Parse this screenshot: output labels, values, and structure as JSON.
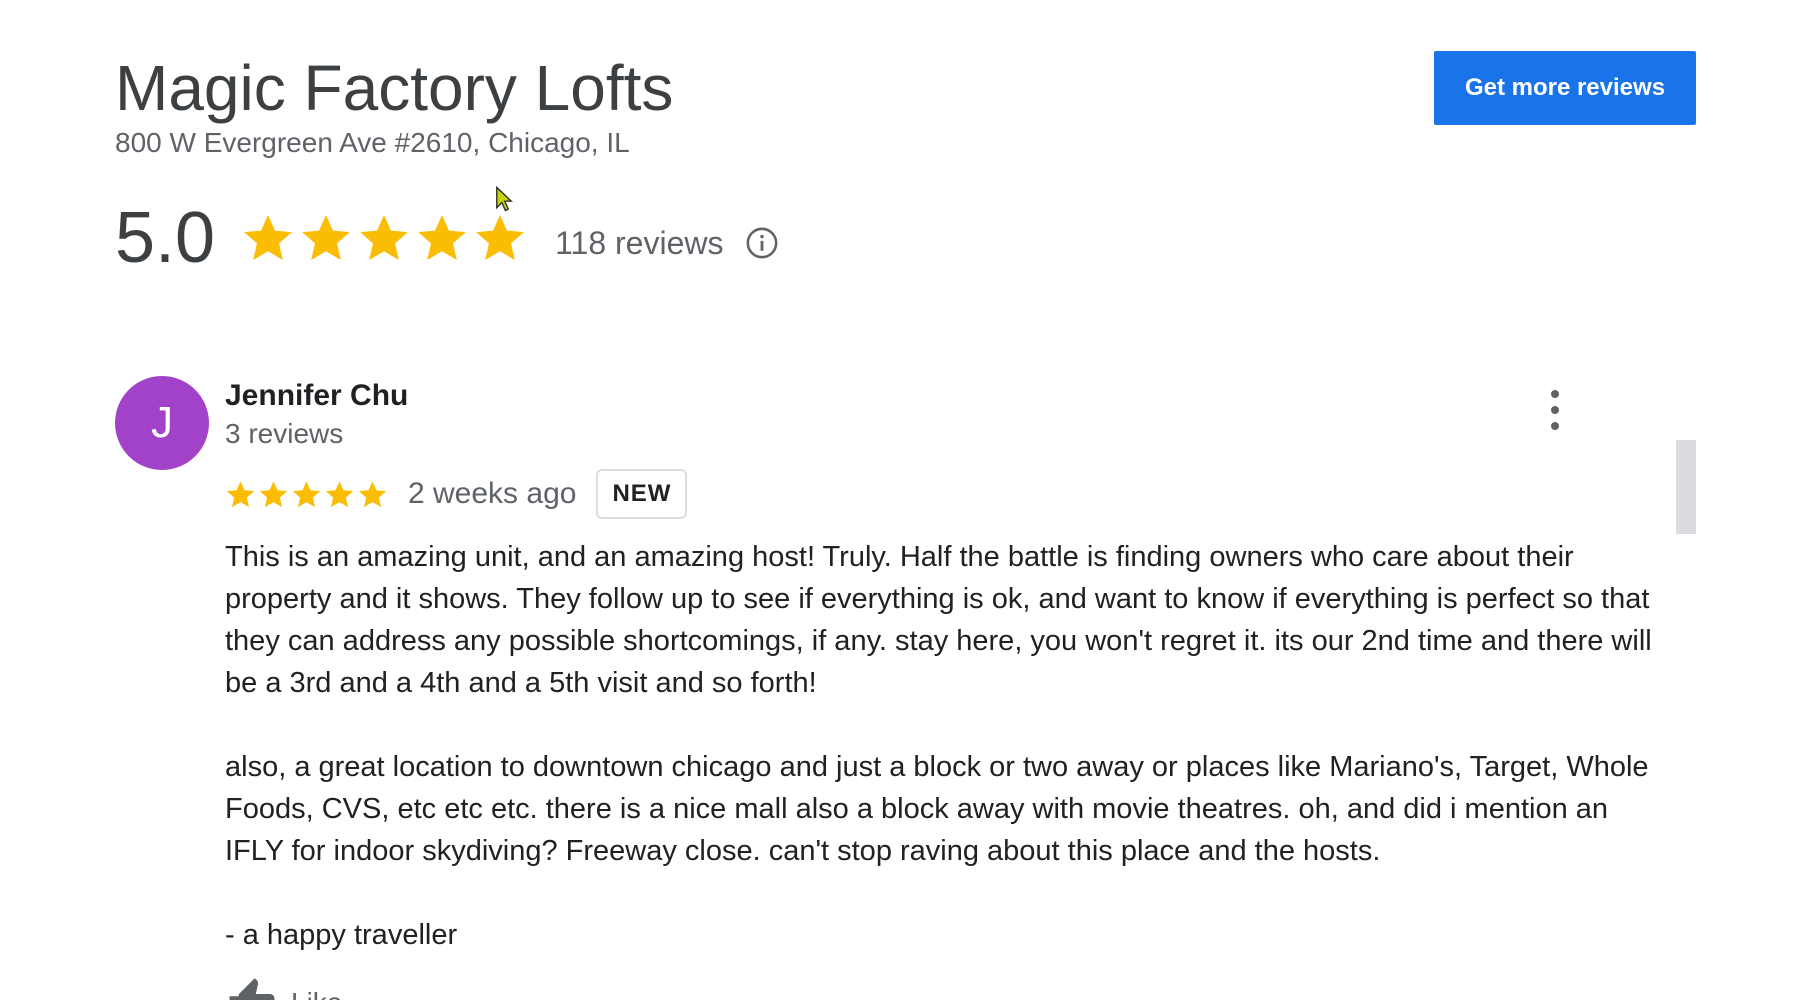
{
  "header": {
    "business_name": "Magic Factory Lofts",
    "address": "800 W Evergreen Ave #2610, Chicago, IL",
    "cta_label": "Get more reviews"
  },
  "summary": {
    "rating": "5.0",
    "rating_value": 5,
    "max_stars": 5,
    "review_count": "118 reviews",
    "star_color": "#fbbc04"
  },
  "colors": {
    "accent": "#1a73e8",
    "avatar": "#a142c9"
  },
  "review": {
    "avatar_initial": "J",
    "reviewer_name": "Jennifer Chu",
    "reviewer_review_count": "3 reviews",
    "stars": 5,
    "date": "2 weeks ago",
    "badge": "NEW",
    "paragraphs": [
      "This is an amazing unit, and an amazing host! Truly.  Half the battle is finding owners who care about their property and it shows.  They follow up to see if everything is ok, and want to know if everything is perfect so that they can address any possible shortcomings, if any.  stay here, you won't regret it.  its our 2nd time and there will be a 3rd and a 4th and a 5th visit and so forth!",
      "also, a great location to downtown chicago and just a block or two away or places like Mariano's, Target, Whole Foods, CVS, etc etc etc.  there is a nice mall also a block away with movie theatres.  oh, and did i mention an IFLY for indoor skydiving?  Freeway close.  can't stop raving about this place and the hosts.",
      "- a happy traveller"
    ],
    "like_label": "Like"
  },
  "icons": {
    "info": "info-icon",
    "more": "more-vertical-icon",
    "like": "thumbs-up-icon",
    "star": "star-icon"
  }
}
